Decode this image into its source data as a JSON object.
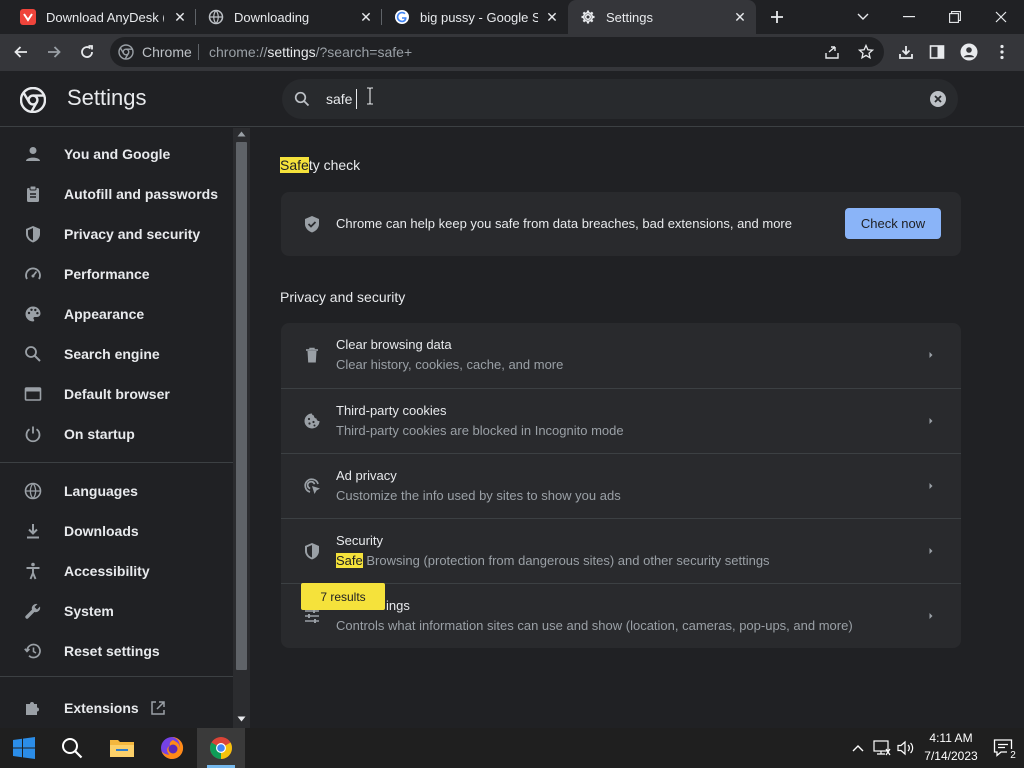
{
  "tabs": [
    {
      "label": "Download AnyDesk (Po",
      "icon": "anydesk-icon",
      "active": false
    },
    {
      "label": "Downloading",
      "icon": "globe-icon",
      "active": false
    },
    {
      "label": "big pussy - Google Sea",
      "icon": "google-icon",
      "active": false
    },
    {
      "label": "Settings",
      "icon": "gear-icon",
      "active": true
    }
  ],
  "omnibox": {
    "site_label": "Chrome",
    "url_scheme": "chrome://",
    "url_host": "settings",
    "url_rest": "/?search=safe+"
  },
  "header": {
    "title": "Settings",
    "search_value": "safe"
  },
  "sidebar": {
    "items": [
      {
        "label": "You and Google",
        "icon": "person-icon"
      },
      {
        "label": "Autofill and passwords",
        "icon": "clipboard-icon"
      },
      {
        "label": "Privacy and security",
        "icon": "shield-icon"
      },
      {
        "label": "Performance",
        "icon": "speedometer-icon"
      },
      {
        "label": "Appearance",
        "icon": "palette-icon"
      },
      {
        "label": "Search engine",
        "icon": "search-icon"
      },
      {
        "label": "Default browser",
        "icon": "browser-window-icon"
      },
      {
        "label": "On startup",
        "icon": "power-icon"
      },
      {
        "label": "Languages",
        "icon": "globe-icon"
      },
      {
        "label": "Downloads",
        "icon": "download-icon"
      },
      {
        "label": "Accessibility",
        "icon": "accessibility-icon"
      },
      {
        "label": "System",
        "icon": "wrench-icon"
      },
      {
        "label": "Reset settings",
        "icon": "history-icon"
      },
      {
        "label": "Extensions",
        "icon": "puzzle-icon"
      }
    ]
  },
  "safety_check": {
    "title_highlight": "Safe",
    "title_rest": "ty check",
    "description": "Chrome can help keep you safe from data breaches, bad extensions, and more",
    "button_label": "Check now"
  },
  "privacy": {
    "section_title": "Privacy and security",
    "rows": [
      {
        "title": "Clear browsing data",
        "subtitle": "Clear history, cookies, cache, and more",
        "icon": "trash-icon"
      },
      {
        "title": "Third-party cookies",
        "subtitle": "Third-party cookies are blocked in Incognito mode",
        "icon": "cookie-icon"
      },
      {
        "title": "Ad privacy",
        "subtitle": "Customize the info used by sites to show you ads",
        "icon": "ad-privacy-icon"
      },
      {
        "title": "Security",
        "subtitle_highlight": "Safe",
        "subtitle": " Browsing (protection from dangerous sites) and other security settings",
        "icon": "shield-icon"
      },
      {
        "title": "Site settings",
        "title_visible": "ings",
        "subtitle": "Controls what information sites can use and show (location, cameras, pop-ups, and more)",
        "icon": "sliders-icon"
      }
    ]
  },
  "results_bubble": "7 results",
  "taskbar": {
    "time": "4:11 AM",
    "date": "7/14/2023",
    "notification_count": "2"
  },
  "colors": {
    "accent": "#8ab4f8",
    "highlight": "#f5e23b",
    "background": "#202124",
    "card": "#292a2d"
  }
}
